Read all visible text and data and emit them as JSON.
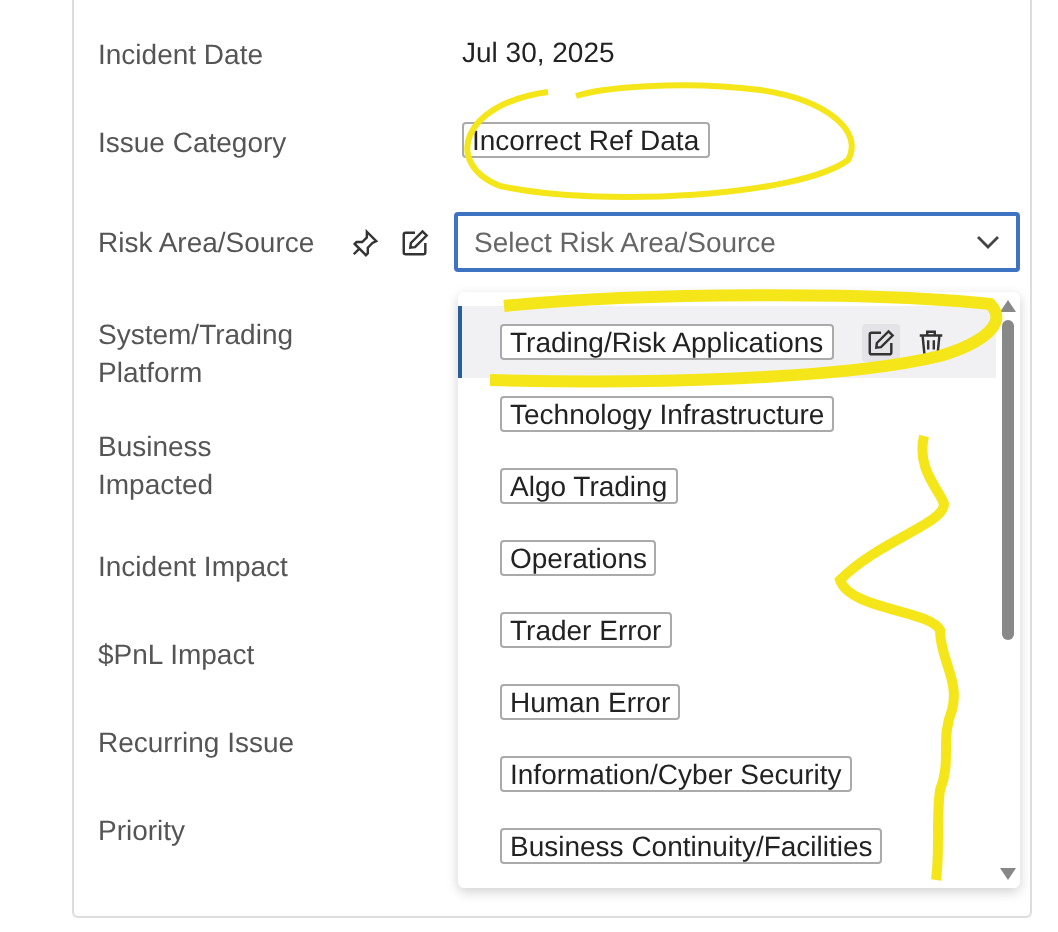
{
  "fields": [
    {
      "label": "Incident Date",
      "kind": "text",
      "value": "Jul 30, 2025"
    },
    {
      "label": "Issue Category",
      "kind": "tag",
      "value": "Incorrect Ref Data"
    },
    {
      "label": "Risk Area/Source",
      "kind": "select",
      "placeholder": "Select Risk Area/Source",
      "focused": true
    },
    {
      "label": "System/Trading Platform",
      "kind": "empty"
    },
    {
      "label": "Business Impacted",
      "kind": "empty"
    },
    {
      "label": "Incident Impact",
      "kind": "empty"
    },
    {
      "label": "$PnL Impact",
      "kind": "empty"
    },
    {
      "label": "Recurring Issue",
      "kind": "empty"
    },
    {
      "label": "Priority",
      "kind": "empty"
    }
  ],
  "dropdown": {
    "options": [
      {
        "label": "Trading/Risk Applications",
        "selected": true
      },
      {
        "label": "Technology Infrastructure",
        "selected": false
      },
      {
        "label": "Algo Trading",
        "selected": false
      },
      {
        "label": "Operations",
        "selected": false
      },
      {
        "label": "Trader Error",
        "selected": false
      },
      {
        "label": "Human Error",
        "selected": false
      },
      {
        "label": "Information/Cyber Security",
        "selected": false
      },
      {
        "label": "Business Continuity/Facilities",
        "selected": false
      }
    ]
  }
}
